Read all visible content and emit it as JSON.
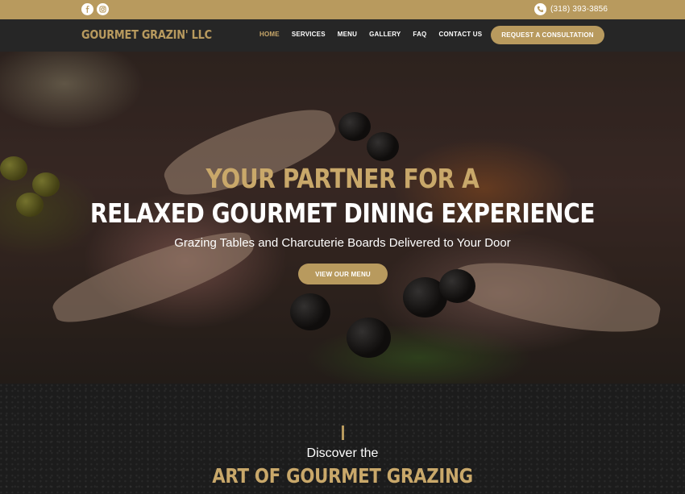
{
  "topbar": {
    "social": [
      {
        "name": "facebook",
        "icon": "facebook-icon"
      },
      {
        "name": "instagram",
        "icon": "instagram-icon"
      }
    ],
    "phone": "(318) 393-3856",
    "phone_icon": "phone-icon"
  },
  "nav": {
    "logo": "GOURMET GRAZIN' LLC",
    "links": [
      "HOME",
      "SERVICES",
      "MENU",
      "GALLERY",
      "FAQ",
      "CONTACT US"
    ],
    "active": "HOME",
    "cta": "REQUEST A CONSULTATION"
  },
  "hero": {
    "line1": "YOUR PARTNER FOR A",
    "line2": "RELAXED GOURMET DINING EXPERIENCE",
    "subtitle": "Grazing Tables and Charcuterie Boards Delivered to Your Door",
    "button": "VIEW OUR MENU"
  },
  "discover": {
    "line1": "Discover the",
    "line2": "ART OF GOURMET GRAZING"
  },
  "colors": {
    "gold": "#b89a5e",
    "gold_text": "#c9a86a",
    "nav_bg": "#262626",
    "dark_bg": "#1c1c1c"
  }
}
